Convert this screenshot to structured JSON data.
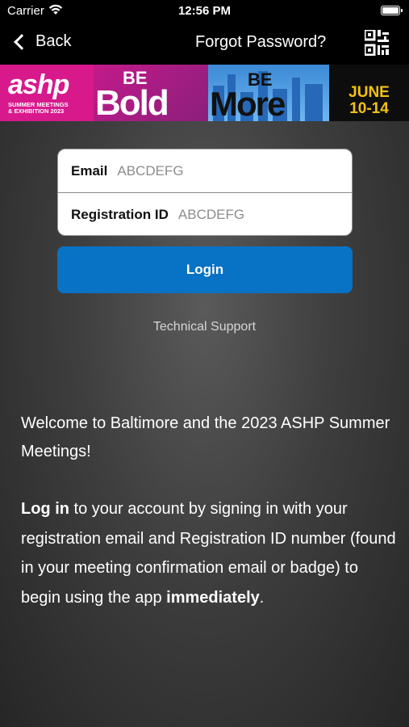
{
  "status_bar": {
    "carrier": "Carrier",
    "time": "12:56 PM"
  },
  "nav": {
    "back_label": "Back",
    "forgot_label": "Forgot Password?",
    "qr_icon": "qr-code-icon"
  },
  "banner": {
    "logo": "ashp",
    "subtitle_line1": "SUMMER MEETINGS",
    "subtitle_line2": "& EXHIBITION 2023",
    "be1": "BE",
    "bold": "Bold",
    "be2": "BE",
    "more": "More",
    "date_line1": "JUNE",
    "date_line2": "10-14",
    "colors": {
      "pink": "#d8198c",
      "sky": "#3c8ad6",
      "gold": "#f2c20f"
    }
  },
  "form": {
    "email_label": "Email",
    "email_placeholder": "ABCDEFG",
    "registration_label": "Registration ID",
    "registration_placeholder": "ABCDEFG",
    "login_label": "Login"
  },
  "support_label": "Technical Support",
  "welcome_text": "Welcome to Baltimore and the 2023 ASHP Summer Meetings!",
  "info": {
    "bold1": "Log in",
    "text1": " to your account by signing in with your registration email and Registration ID number (found in your meeting confirmation email or badge) to begin using the app ",
    "bold2": "immediately",
    "text2": "."
  },
  "accent_color": "#0872c4"
}
